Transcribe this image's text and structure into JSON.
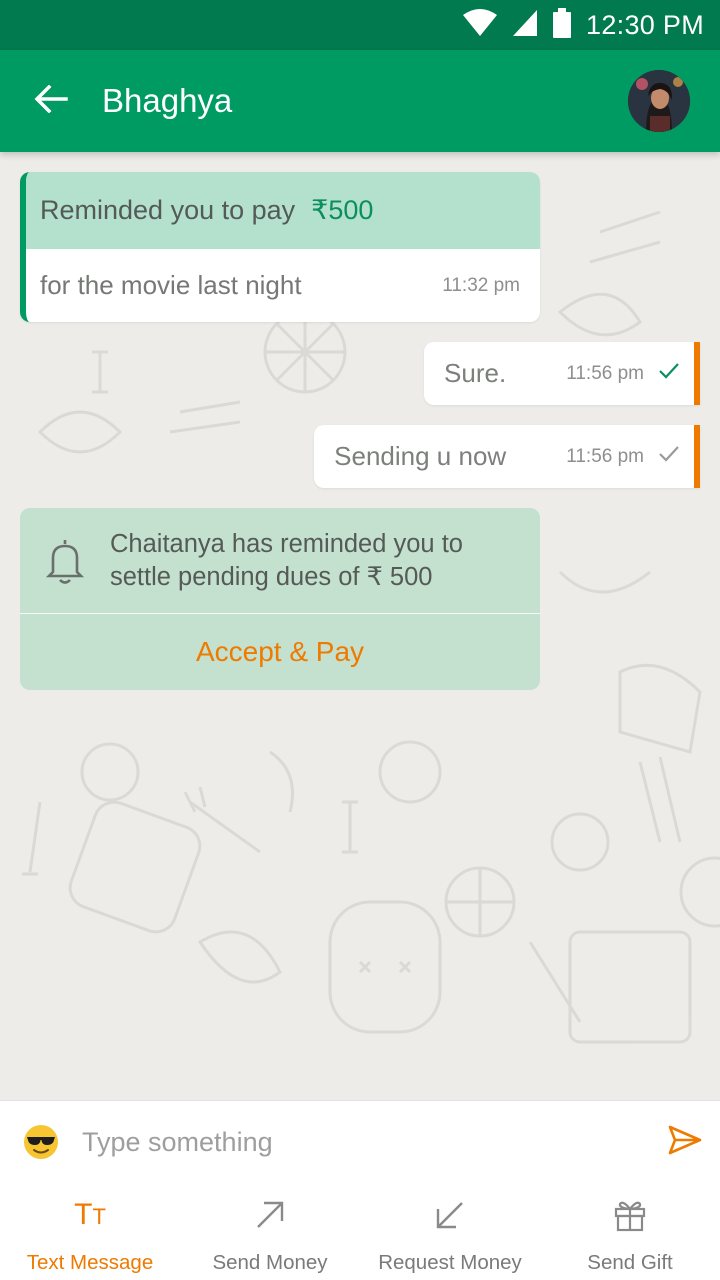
{
  "status_bar": {
    "time": "12:30 PM",
    "icons": [
      "wifi-icon",
      "signal-icon",
      "battery-icon"
    ]
  },
  "header": {
    "back_icon": "arrow-left-icon",
    "contact_name": "Bhaghya",
    "avatar": "contact-avatar"
  },
  "messages": [
    {
      "direction": "incoming",
      "type": "payment-reminder",
      "title": "Reminded you to pay",
      "amount": "₹500",
      "note": "for the movie last night",
      "time": "11:32 pm"
    },
    {
      "direction": "outgoing",
      "text": "Sure.",
      "time": "11:56 pm",
      "status_icon": "check-icon",
      "status_color": "#0b8f5e"
    },
    {
      "direction": "outgoing",
      "text": "Sending u now",
      "time": "11:56 pm",
      "status_icon": "check-icon",
      "status_color": "#9a9a9a"
    }
  ],
  "reminder_card": {
    "icon": "bell-icon",
    "line1": "Chaitanya has reminded you to",
    "line2": "settle pending dues of ₹ 500",
    "action_label": "Accept & Pay"
  },
  "composer": {
    "emoji_icon": "sunglasses-emoji-icon",
    "placeholder": "Type something",
    "value": "",
    "send_icon": "send-icon"
  },
  "tabs": [
    {
      "label": "Text Message",
      "icon": "text-format-icon",
      "active": true
    },
    {
      "label": "Send Money",
      "icon": "arrow-up-right-icon",
      "active": false
    },
    {
      "label": "Request Money",
      "icon": "arrow-down-left-icon",
      "active": false
    },
    {
      "label": "Send Gift",
      "icon": "gift-icon",
      "active": false
    }
  ],
  "colors": {
    "status_bar": "#007a4e",
    "app_bar": "#009a63",
    "accent": "#ef7a00",
    "incoming_header": "#b4e0ce",
    "reminder_bg": "#b7dec7"
  }
}
